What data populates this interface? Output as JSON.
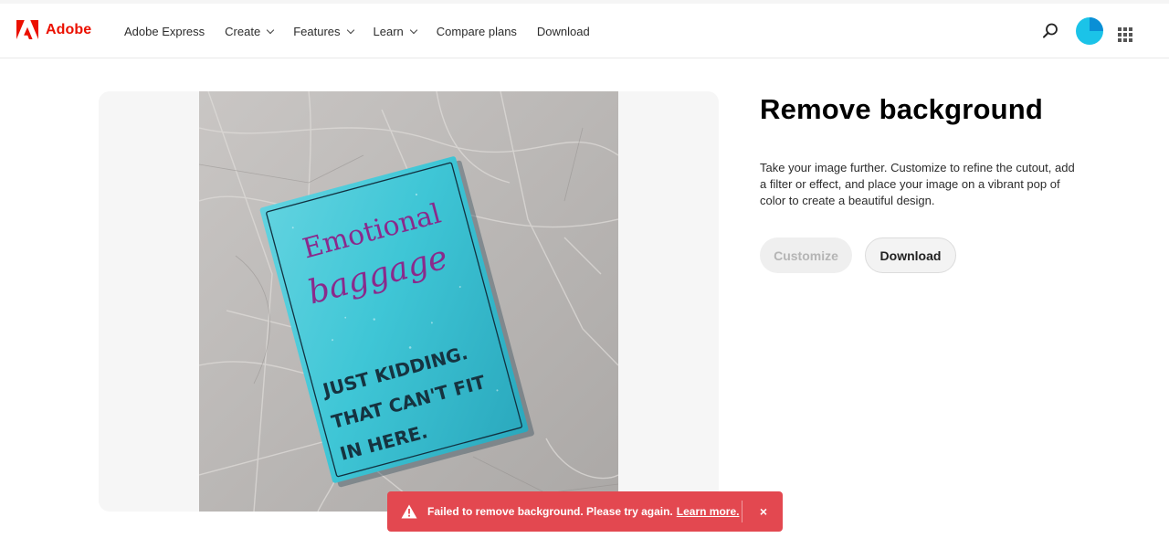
{
  "brand": {
    "name": "Adobe"
  },
  "nav": {
    "items": [
      {
        "label": "Adobe Express"
      },
      {
        "label": "Create"
      },
      {
        "label": "Features"
      },
      {
        "label": "Learn"
      },
      {
        "label": "Compare plans"
      },
      {
        "label": "Download"
      }
    ]
  },
  "main": {
    "title": "Remove background",
    "description": "Take your image further. Customize to refine the cutout, add a filter or effect, and place your image on a vibrant pop of color to create a beautiful design.",
    "customize_label": "Customize",
    "download_label": "Download"
  },
  "photo": {
    "line1": "Emotional",
    "line2": "baggage",
    "line3": "JUST KIDDING.",
    "line4": "THAT CAN'T FIT",
    "line5": "IN HERE."
  },
  "toast": {
    "message": "Failed to remove background. Please try again.",
    "link": "Learn more.",
    "close": "×"
  },
  "colors": {
    "brand_red": "#eb1000",
    "toast_red": "#e34850",
    "card_teal": "#3fc6d6",
    "text_purple": "#8a2a8c"
  },
  "icons": [
    "adobe-logo-icon",
    "search-icon",
    "avatar",
    "apps-grid-icon",
    "warning-icon",
    "close-icon"
  ]
}
